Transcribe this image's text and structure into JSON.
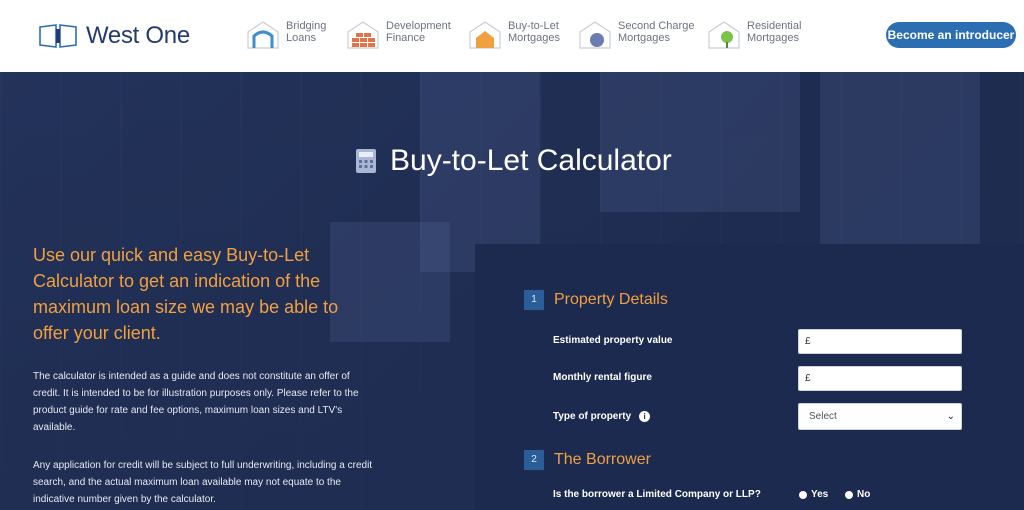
{
  "brand": {
    "name": "West One"
  },
  "nav": [
    {
      "line1": "Bridging",
      "line2": "Loans",
      "icon": "bridge-icon"
    },
    {
      "line1": "Development",
      "line2": "Finance",
      "icon": "bricks-icon"
    },
    {
      "line1": "Buy-to-Let",
      "line2": "Mortgages",
      "icon": "house-icon"
    },
    {
      "line1": "Second Charge",
      "line2": "Mortgages",
      "icon": "circle-house-icon"
    },
    {
      "line1": "Residential",
      "line2": "Mortgages",
      "icon": "tree-house-icon"
    }
  ],
  "cta_label": "Become an introducer",
  "page_title": "Buy-to-Let Calculator",
  "intro": "Use our quick and easy Buy-to-Let Calculator to get an indication of the maximum loan size we may be able to offer your client.",
  "para1": "The calculator is intended as a guide and does not constitute an offer of credit. It is intended to be for illustration purposes only. Please refer to the product guide for rate and fee options, maximum loan sizes and LTV's available.",
  "para2": "Any application for credit will be subject to full underwriting, including a credit search, and the actual maximum loan available may not equate to the indicative number given by the calculator.",
  "steps": [
    {
      "num": "1",
      "title": "Property Details"
    },
    {
      "num": "2",
      "title": "The Borrower"
    }
  ],
  "fields": {
    "property_value": {
      "label": "Estimated property value",
      "value": "£"
    },
    "rental": {
      "label": "Monthly rental figure",
      "value": "£"
    },
    "type": {
      "label": "Type of property",
      "selected": "Select"
    },
    "limited": {
      "label": "Is the borrower a Limited Company or LLP?",
      "yes": "Yes",
      "no": "No"
    }
  },
  "colors": {
    "navy": "#1f2d52",
    "orange": "#f0a041",
    "blue": "#2b6fb2"
  }
}
